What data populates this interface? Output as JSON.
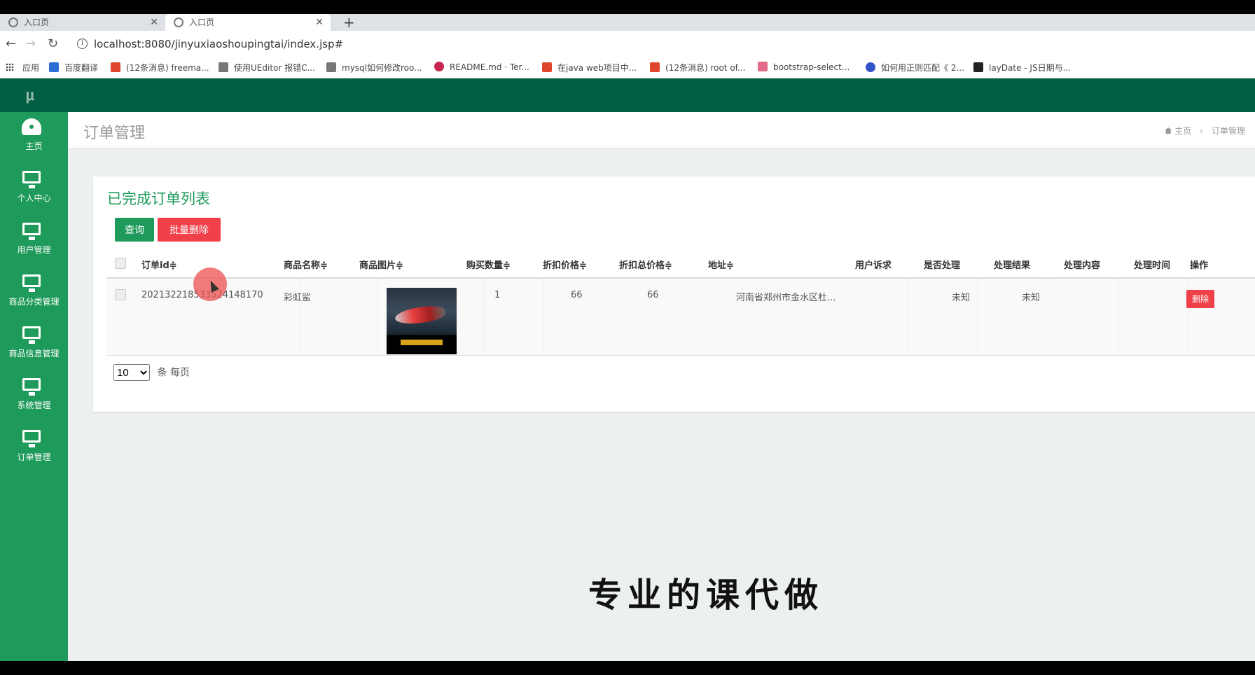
{
  "browser": {
    "tabs": [
      {
        "title": "入口页"
      },
      {
        "title": "入口页"
      }
    ],
    "new_tab": "+",
    "url": "localhost:8080/jinyuxiaoshoupingtai/index.jsp#",
    "bookmarks": [
      {
        "label": "应用",
        "color": "#555555"
      },
      {
        "label": "百度翻译",
        "color": "#2b6fd6"
      },
      {
        "label": "(12条消息) freema...",
        "color": "#e0452e"
      },
      {
        "label": "使用UEditor 报错C...",
        "color": "#333333"
      },
      {
        "label": "mysql如何修改roo...",
        "color": "#333333"
      },
      {
        "label": "README.md · Ter...",
        "color": "#c7254e"
      },
      {
        "label": "在java web项目中...",
        "color": "#e0452e"
      },
      {
        "label": "(12条消息) root of...",
        "color": "#e0452e"
      },
      {
        "label": "bootstrap-select...",
        "color": "#e26a8a"
      },
      {
        "label": "如何用正则匹配《 2...",
        "color": "#3355cc"
      },
      {
        "label": "layDate - JS日期与...",
        "color": "#222222"
      }
    ]
  },
  "app": {
    "logo": "μ",
    "sidebar": [
      {
        "label": "主页",
        "icon": "dashboard-icon"
      },
      {
        "label": "个人中心",
        "icon": "monitor-icon"
      },
      {
        "label": "用户管理",
        "icon": "monitor-icon"
      },
      {
        "label": "商品分类管理",
        "icon": "monitor-icon"
      },
      {
        "label": "商品信息管理",
        "icon": "monitor-icon"
      },
      {
        "label": "系统管理",
        "icon": "monitor-icon"
      },
      {
        "label": "订单管理",
        "icon": "monitor-icon"
      }
    ],
    "page_title": "订单管理",
    "breadcrumb": {
      "home": "主页",
      "separator": "›",
      "current": "订单管理"
    },
    "card": {
      "title": "已完成订单列表",
      "query_button": "查询",
      "batch_delete_button": "批量删除",
      "columns": [
        "订单id≑",
        "商品名称≑",
        "商品图片≑",
        "购买数量≑",
        "折扣价格≑",
        "折扣总价格≑",
        "地址≑",
        "用户诉求",
        "是否处理",
        "处理结果",
        "处理内容",
        "处理时间",
        "操作"
      ],
      "rows": [
        {
          "order_id": "202132218533524148170",
          "product_name": "彩虹鲨",
          "quantity": "1",
          "discount_price": "66",
          "discount_total": "66",
          "address": "河南省郑州市金水区杜...",
          "user_request": "",
          "processed": "未知",
          "result": "未知",
          "content": "",
          "time": "",
          "action": "删除"
        }
      ],
      "page_size": "10",
      "page_size_suffix": "条 每页"
    }
  },
  "overlay_text": "专业的课代做"
}
